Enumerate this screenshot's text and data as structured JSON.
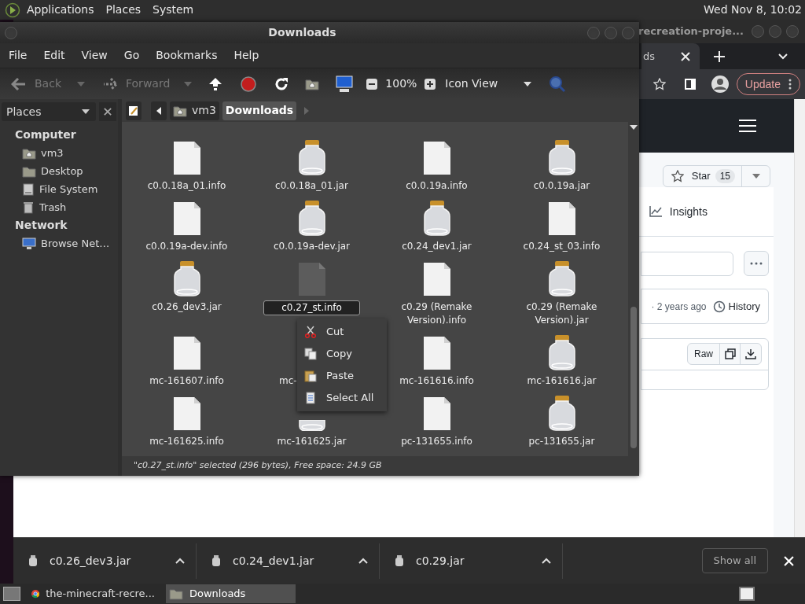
{
  "top_panel": {
    "menus": [
      "Applications",
      "Places",
      "System"
    ],
    "clock": "Wed Nov 8, 10:02"
  },
  "browser": {
    "title": "recreation-proje...",
    "tab": "ds",
    "update_button": "Update",
    "star_label": "Star",
    "star_count": "15",
    "nav_item": "Insights",
    "commit_meta": "· 2 years ago",
    "history_button": "History",
    "raw_button": "Raw"
  },
  "file_manager": {
    "title": "Downloads",
    "menu": [
      "File",
      "Edit",
      "View",
      "Go",
      "Bookmarks",
      "Help"
    ],
    "toolbar": {
      "back": {
        "label": "Back",
        "disabled": true
      },
      "forward": {
        "label": "Forward",
        "disabled": true
      },
      "zoom": "100%",
      "view": "Icon View"
    },
    "sidebar": {
      "header": "Places",
      "sections": [
        {
          "label": "Computer",
          "items": [
            {
              "label": "vm3",
              "kind": "home"
            },
            {
              "label": "Desktop",
              "kind": "desktop"
            },
            {
              "label": "File System",
              "kind": "drive"
            },
            {
              "label": "Trash",
              "kind": "trash"
            }
          ]
        },
        {
          "label": "Network",
          "items": [
            {
              "label": "Browse Net…",
              "kind": "network"
            }
          ]
        }
      ]
    },
    "path": [
      {
        "label": "vm3",
        "selected": false
      },
      {
        "label": "Downloads",
        "selected": true
      }
    ],
    "files": [
      {
        "name": "c0.0.18a_01.info",
        "kind": "info",
        "selected": false
      },
      {
        "name": "c0.0.18a_01.jar",
        "kind": "jar",
        "selected": false
      },
      {
        "name": "c0.0.19a.info",
        "kind": "info",
        "selected": false
      },
      {
        "name": "c0.0.19a.jar",
        "kind": "jar",
        "selected": false
      },
      {
        "name": "c0.0.19a-dev.info",
        "kind": "info",
        "selected": false
      },
      {
        "name": "c0.0.19a-dev.jar",
        "kind": "jar",
        "selected": false
      },
      {
        "name": "c0.24_dev1.jar",
        "kind": "jar",
        "selected": false
      },
      {
        "name": "c0.24_st_03.info",
        "kind": "info",
        "selected": false
      },
      {
        "name": "c0.26_dev3.jar",
        "kind": "jar",
        "selected": false
      },
      {
        "name": "c0.27_st.info",
        "kind": "info",
        "selected": true
      },
      {
        "name": "c0.29 (Remake Version).info",
        "kind": "info",
        "selected": false
      },
      {
        "name": "c0.29 (Remake Version).jar",
        "kind": "jar",
        "selected": false
      },
      {
        "name": "mc-161607.info",
        "kind": "info",
        "selected": false
      },
      {
        "name": "mc-",
        "kind": "covered",
        "selected": false
      },
      {
        "name": "mc-161616.info",
        "kind": "info",
        "selected": false
      },
      {
        "name": "mc-161616.jar",
        "kind": "jar",
        "selected": false
      },
      {
        "name": "mc-161625.info",
        "kind": "info",
        "selected": false
      },
      {
        "name": "mc-161625.jar",
        "kind": "jar_bottom",
        "selected": false
      },
      {
        "name": "pc-131655.info",
        "kind": "info",
        "selected": false
      },
      {
        "name": "pc-131655.jar",
        "kind": "jar",
        "selected": false
      }
    ],
    "context_menu": [
      {
        "label": "Cut",
        "kind": "cut"
      },
      {
        "label": "Copy",
        "kind": "copy"
      },
      {
        "label": "Paste",
        "kind": "paste"
      },
      {
        "label": "Select All",
        "kind": "select_all"
      }
    ],
    "status": "\"c0.27_st.info\" selected (296 bytes), Free space: 24.9 GB"
  },
  "downloads_bar": {
    "items": [
      "c0.26_dev3.jar",
      "c0.24_dev1.jar",
      "c0.29.jar"
    ],
    "show_all": "Show all"
  },
  "taskbar": {
    "items": [
      {
        "label": "the-minecraft-recre...",
        "kind": "browser",
        "selected": false
      },
      {
        "label": "Downloads",
        "kind": "folder",
        "selected": true
      }
    ]
  }
}
